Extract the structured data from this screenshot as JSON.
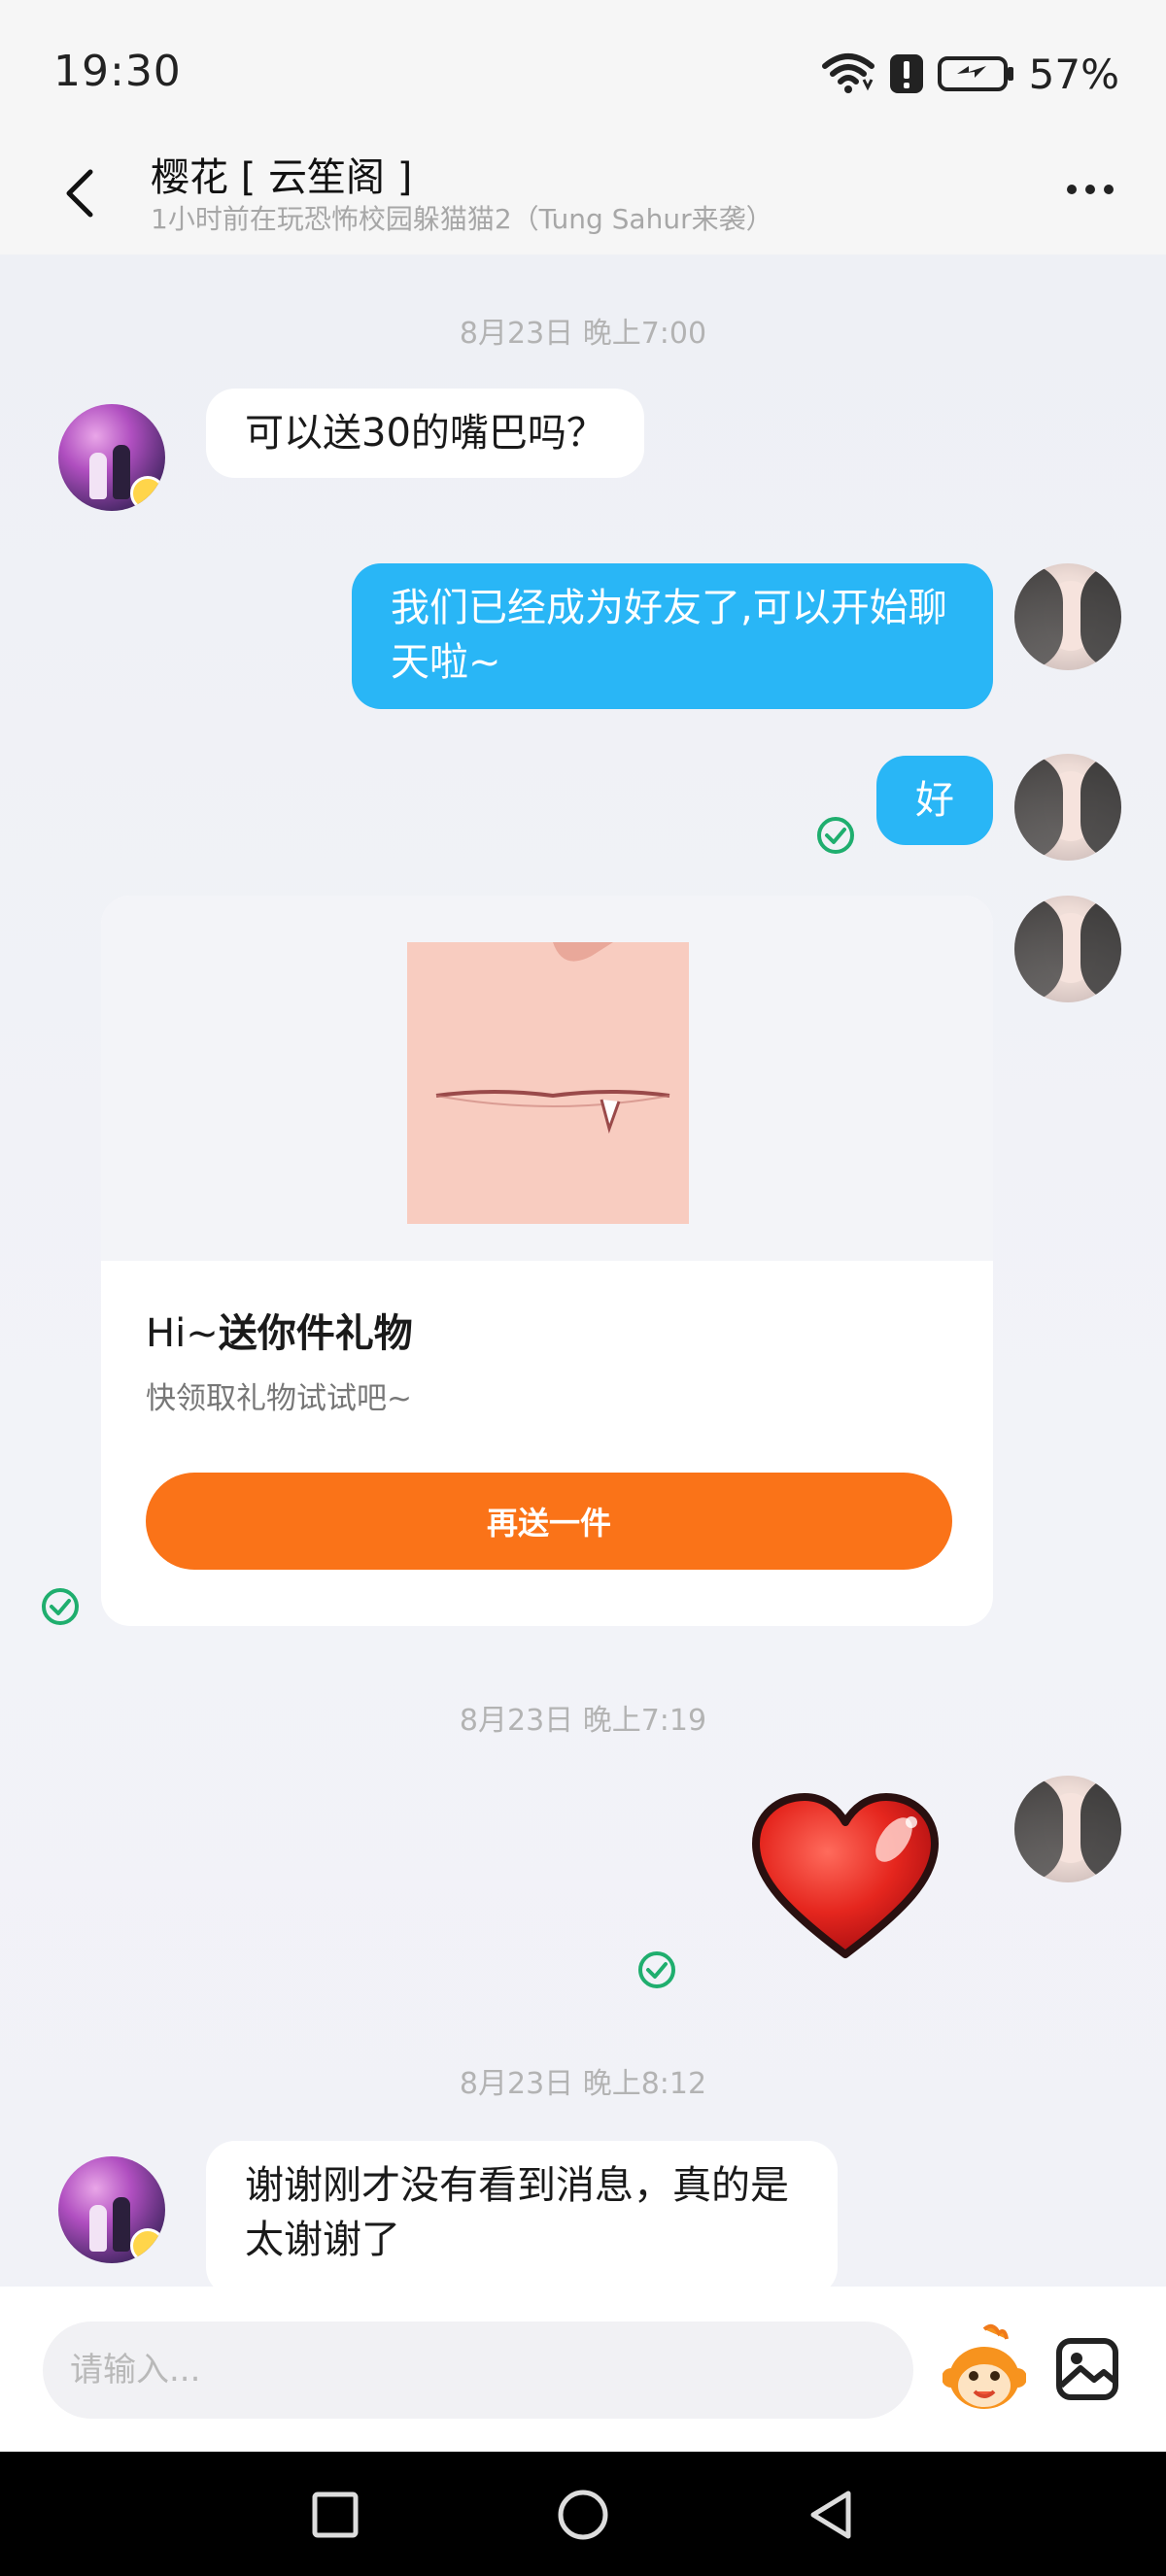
{
  "status_bar": {
    "time": "19:30",
    "battery": "57%",
    "icons": [
      "wifi-icon",
      "alert-icon",
      "battery-charging-icon"
    ]
  },
  "header": {
    "title": "樱花 [ 云笙阁 ]",
    "subtitle": "1小时前在玩恐怖校园躲猫猫2（Tung Sahur来袭）",
    "back_icon": "chevron-left-icon",
    "more_icon": "more-horizontal-icon"
  },
  "messages": [
    {
      "type": "timestamp",
      "text": "8月23日 晚上7:00"
    },
    {
      "type": "incoming",
      "text": "可以送30的嘴巴吗？"
    },
    {
      "type": "outgoing",
      "text": "我们已经成为好友了,可以开始聊天啦~"
    },
    {
      "type": "outgoing",
      "text": "好"
    },
    {
      "type": "gift",
      "title_prefix": "Hi~",
      "title_bold": "送你件礼物",
      "subtitle": "快领取礼物试试吧~",
      "button": "再送一件"
    },
    {
      "type": "timestamp",
      "text": "8月23日 晚上7:19"
    },
    {
      "type": "sticker",
      "sticker": "red-heart"
    },
    {
      "type": "timestamp",
      "text": "8月23日 晚上8:12"
    },
    {
      "type": "incoming",
      "text": "谢谢刚才没有看到消息，真的是太谢谢了"
    }
  ],
  "input": {
    "placeholder": "请输入..."
  },
  "colors": {
    "outgoing_bubble": "#29b6f6",
    "gift_button": "#fa7318",
    "read_check": "#1fae6e"
  }
}
